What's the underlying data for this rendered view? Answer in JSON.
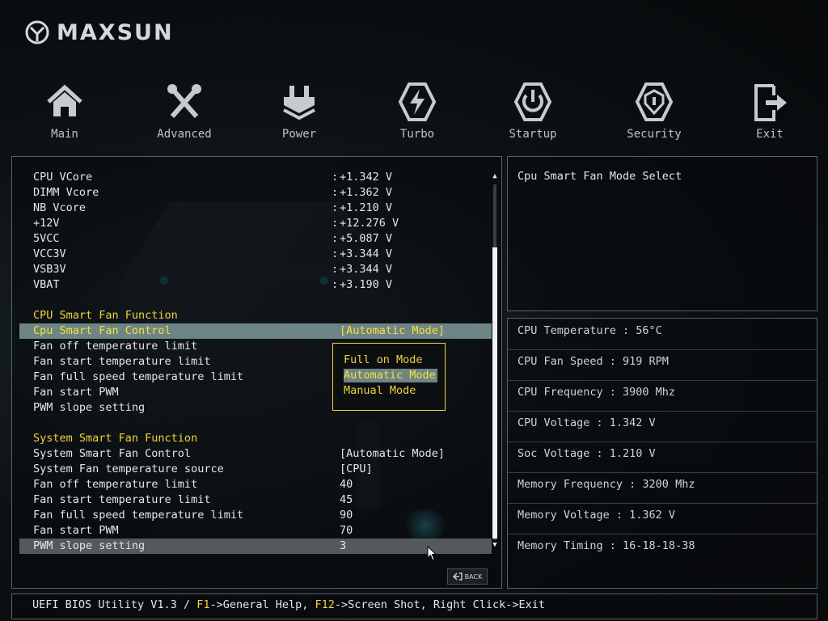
{
  "brand": {
    "name": "MAXSUN"
  },
  "nav": [
    {
      "label": "Main",
      "icon": "home-icon"
    },
    {
      "label": "Advanced",
      "icon": "tools-icon"
    },
    {
      "label": "Power",
      "icon": "power-plug-icon"
    },
    {
      "label": "Turbo",
      "icon": "lightning-icon"
    },
    {
      "label": "Startup",
      "icon": "power-button-icon"
    },
    {
      "label": "Security",
      "icon": "shield-icon"
    },
    {
      "label": "Exit",
      "icon": "exit-icon"
    }
  ],
  "voltages": [
    {
      "label": "CPU VCore",
      "value": "+1.342 V"
    },
    {
      "label": "DIMM Vcore",
      "value": "+1.362 V"
    },
    {
      "label": "NB Vcore",
      "value": "+1.210 V"
    },
    {
      "label": "+12V",
      "value": "+12.276 V"
    },
    {
      "label": "5VCC",
      "value": "+5.087 V"
    },
    {
      "label": "VCC3V",
      "value": "+3.344 V"
    },
    {
      "label": "VSB3V",
      "value": "+3.344 V"
    },
    {
      "label": "VBAT",
      "value": "+3.190 V"
    }
  ],
  "separator": ":",
  "cpu_fan": {
    "section_title": "CPU Smart Fan Function",
    "items": [
      {
        "label": "Cpu Smart Fan Control",
        "value": "[Automatic Mode]"
      },
      {
        "label": "Fan off temperature limit",
        "value": ""
      },
      {
        "label": "Fan start temperature limit",
        "value": ""
      },
      {
        "label": "Fan full speed temperature limit",
        "value": ""
      },
      {
        "label": "Fan start PWM",
        "value": ""
      },
      {
        "label": "PWM slope setting",
        "value": ""
      }
    ]
  },
  "system_fan": {
    "section_title": "System Smart Fan Function",
    "items": [
      {
        "label": "System Smart Fan Control",
        "value": "[Automatic Mode]"
      },
      {
        "label": "System Fan temperature source",
        "value": "[CPU]"
      },
      {
        "label": "Fan off temperature limit",
        "value": "40"
      },
      {
        "label": "Fan start temperature limit",
        "value": "45"
      },
      {
        "label": "Fan full speed temperature limit",
        "value": "90"
      },
      {
        "label": "Fan start PWM",
        "value": "70"
      },
      {
        "label": "PWM slope setting",
        "value": "3"
      }
    ]
  },
  "popup": {
    "options": [
      "Full on Mode",
      "Automatic Mode",
      "Manual Mode"
    ],
    "selected": "Automatic Mode"
  },
  "back_label": "BACK",
  "help": {
    "text": "Cpu Smart Fan Mode Select"
  },
  "system_info": [
    "CPU Temperature : 56°C",
    "CPU Fan Speed : 919 RPM",
    "CPU Frequency : 3900 Mhz",
    "CPU Voltage : 1.342 V",
    "Soc Voltage : 1.210 V",
    "Memory Frequency : 3200 Mhz",
    "Memory Voltage : 1.362 V",
    "Memory Timing : 16-18-18-38"
  ],
  "status": {
    "prefix": "UEFI BIOS Utility V1.3 / ",
    "f1_key": "F1",
    "f1_text": "->General Help, ",
    "f12_key": "F12",
    "f12_text": "->Screen Shot, Right Click->Exit"
  },
  "colors": {
    "highlight": "#f0d23c",
    "selected_bg": "#6e8485",
    "panel_border": "#5a6165"
  }
}
